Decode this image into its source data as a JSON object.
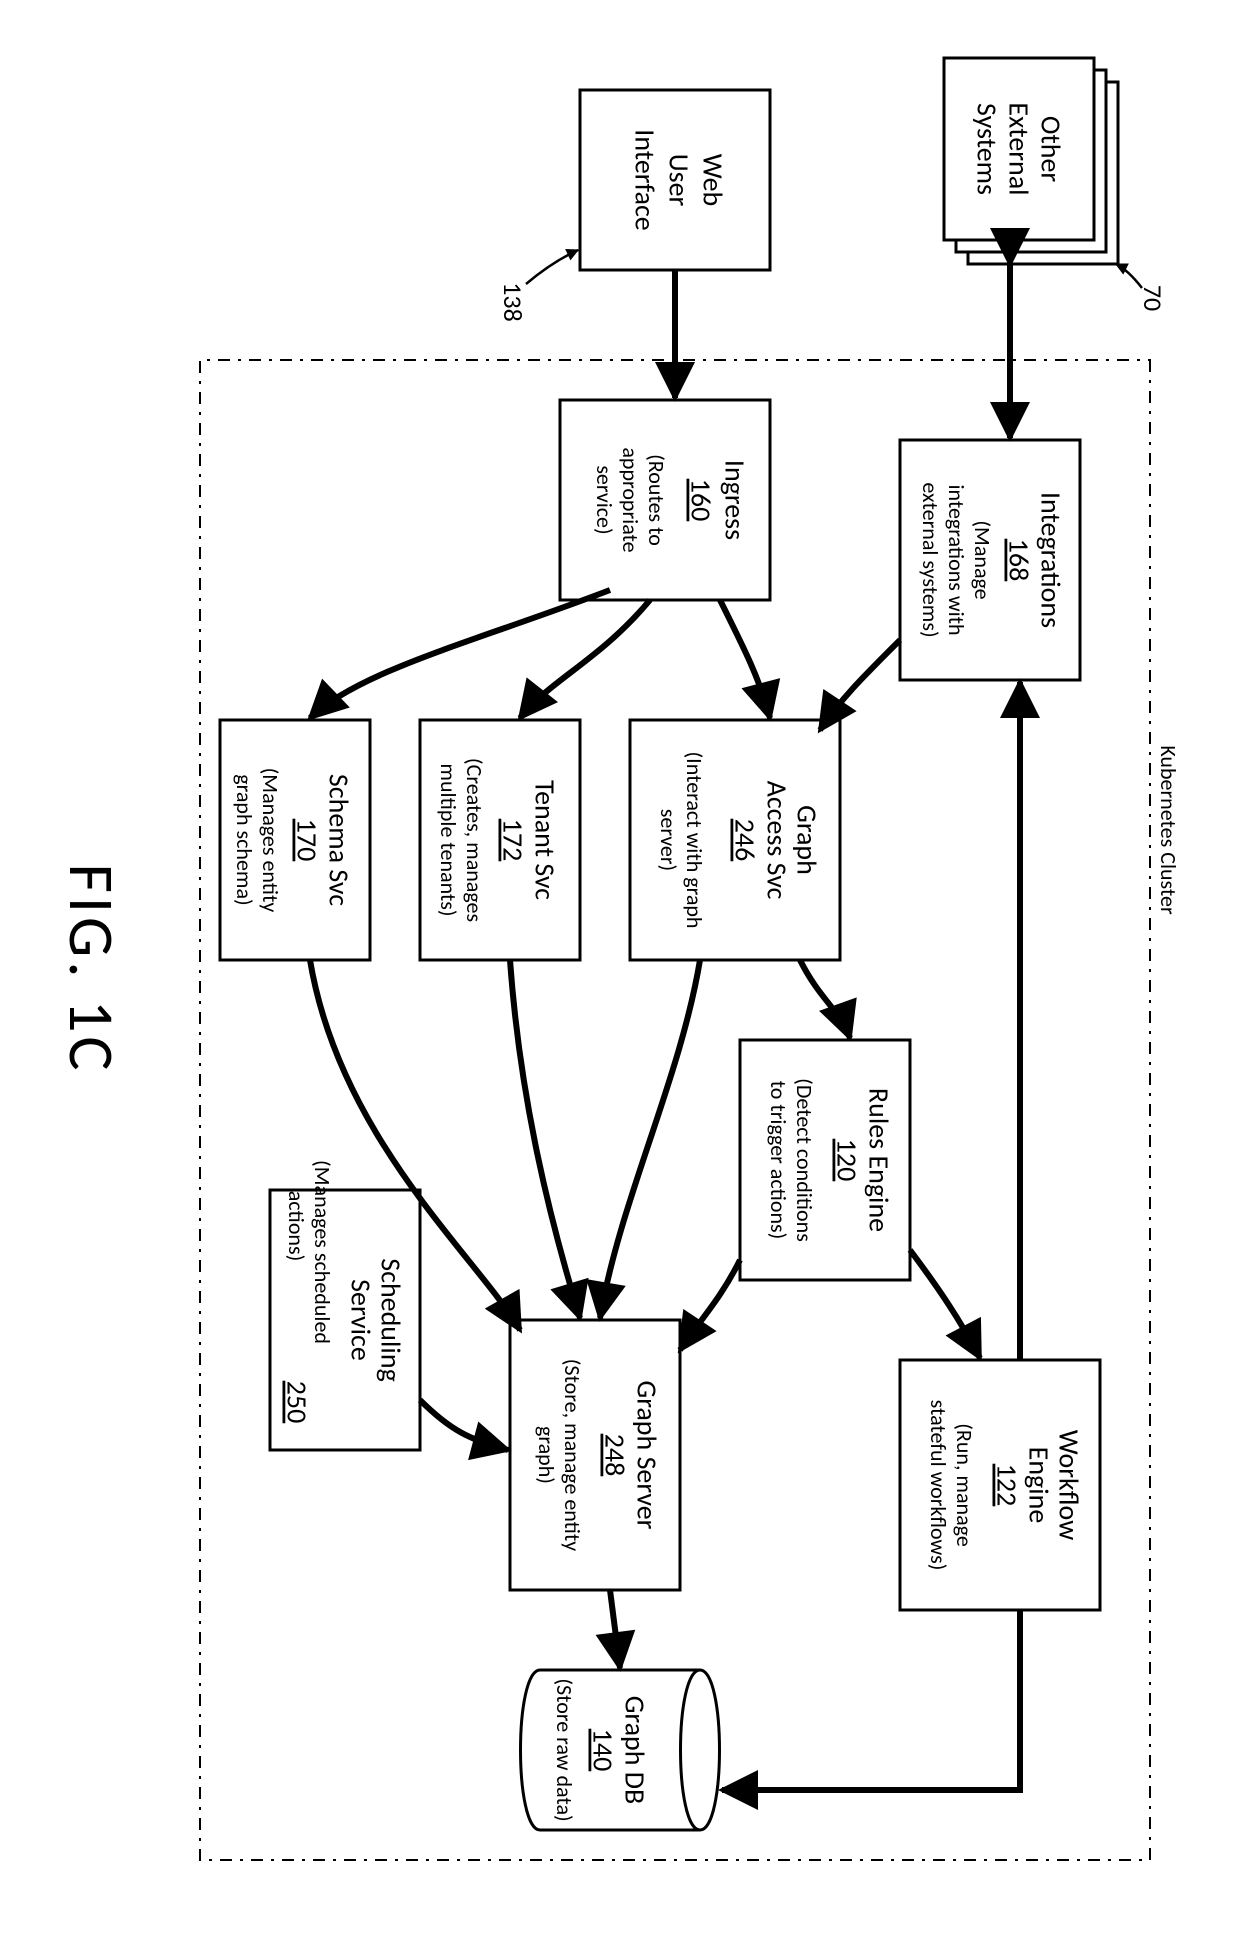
{
  "figure_label": "FIG. 1C",
  "cluster_label": "Kubernetes Cluster",
  "callouts": {
    "ext": "70",
    "web": "138"
  },
  "nodes": {
    "ext": {
      "title_l1": "Other",
      "title_l2": "External",
      "title_l3": "Systems"
    },
    "web": {
      "title_l1": "Web",
      "title_l2": "User",
      "title_l3": "Interface"
    },
    "ingress": {
      "title": "Ingress",
      "num": "160",
      "desc_l1": "(Routes to",
      "desc_l2": "appropriate",
      "desc_l3": "service)"
    },
    "integ": {
      "title": "Integrations",
      "num": "168",
      "desc_l1": "(Manage",
      "desc_l2": "integrations with",
      "desc_l3": "external systems)"
    },
    "gas": {
      "title_l1": "Graph",
      "title_l2": "Access Svc",
      "num": "246",
      "desc_l1": "(Interact with graph",
      "desc_l2": "server)"
    },
    "tenant": {
      "title": "Tenant Svc",
      "num": "172",
      "desc_l1": "(Creates, manages",
      "desc_l2": "multiple tenants)"
    },
    "schema": {
      "title": "Schema Svc",
      "num": "170",
      "desc_l1": "(Manages entity",
      "desc_l2": "graph schema)"
    },
    "rules": {
      "title": "Rules Engine",
      "num": "120",
      "desc_l1": "(Detect conditions",
      "desc_l2": "to trigger actions)"
    },
    "wf": {
      "title_l1": "Workflow",
      "title_l2": "Engine",
      "num": "122",
      "desc_l1": "(Run, manage",
      "desc_l2": "stateful workflows)"
    },
    "gserver": {
      "title": "Graph Server",
      "num": "248",
      "desc_l1": "(Store, manage entity",
      "desc_l2": "graph)"
    },
    "sched": {
      "title_l1": "Scheduling",
      "title_l2": "Service",
      "num": "250",
      "desc_l1": "(Manages scheduled",
      "desc_l2": "actions)"
    },
    "gdb": {
      "title": "Graph DB",
      "num": "140",
      "desc": "(Store raw data)"
    }
  }
}
